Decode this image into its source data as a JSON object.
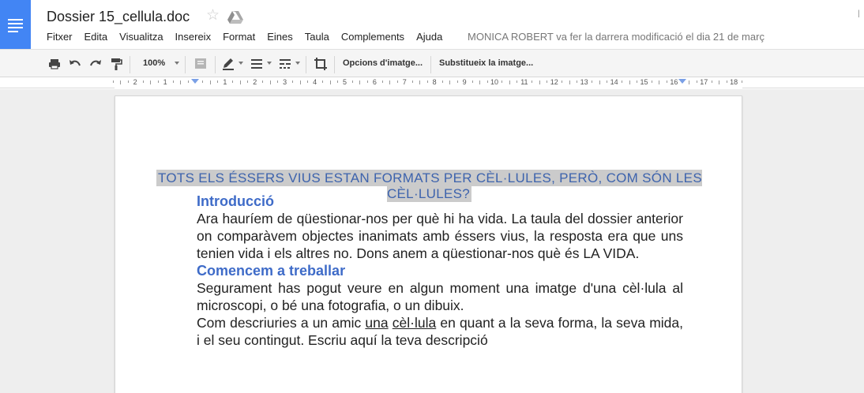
{
  "header": {
    "title": "Dossier 15_cellula.doc",
    "last_edit": "MONICA ROBERT va fer la darrera modificació el dia 21 de març"
  },
  "menu": [
    "Fitxer",
    "Edita",
    "Visualitza",
    "Insereix",
    "Format",
    "Eines",
    "Taula",
    "Complements",
    "Ajuda"
  ],
  "toolbar": {
    "zoom": "100%",
    "image_options": "Opcions d'imatge...",
    "replace_image": "Substitueix la imatge..."
  },
  "ruler": {
    "labels": [
      "2",
      "1",
      "1",
      "2",
      "3",
      "4",
      "5",
      "6",
      "7",
      "8",
      "9",
      "10",
      "11",
      "12",
      "13",
      "14",
      "15",
      "16",
      "17",
      "18"
    ]
  },
  "document": {
    "heading": "TOTS ELS ÉSSERS VIUS ESTAN FORMATS PER CÈL·LULES, PERÒ, COM SÓN LES CÈL·LULES?",
    "section1_title": "Introducció",
    "section1_body": "Ara hauríem de qüestionar-nos per què hi ha vida. La taula del dossier anterior on comparàvem objectes inanimats amb éssers vius, la resposta era que uns tenien vida i els altres no. Dons anem a qüestionar-nos què és LA VIDA.",
    "section2_title": "Comencem a treballar",
    "section2_body1": "Segurament has pogut veure en algun moment una imatge d'una cèl·lula al microscopi, o bé una fotografia, o un dibuix.",
    "section2_body2_a": "Com descriuries a un amic",
    "section2_body2_u1": "una",
    "section2_body2_u2": "cèl·lula",
    "section2_body2_b": "en quant a la seva forma, la seva mida, i el seu contingut. Escriu aquí la teva descripció"
  }
}
